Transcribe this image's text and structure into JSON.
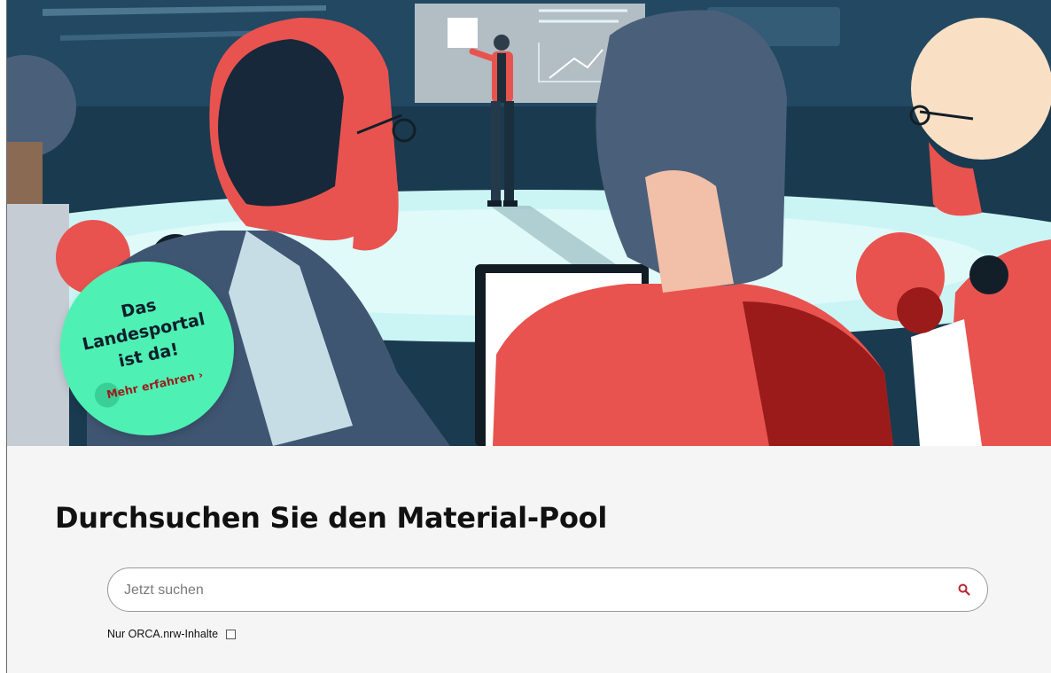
{
  "hero": {
    "badge": {
      "title": "Das\nLandesportal\nist da!",
      "link_label": "Mehr erfahren",
      "link_chevron": "›",
      "color": "#4ff0b4"
    },
    "illustration": "classroom-presentation-illustration"
  },
  "search_section": {
    "headline": "Durchsuchen Sie den Material-Pool",
    "search": {
      "placeholder": "Jetzt suchen",
      "value": "",
      "icon": "search-icon",
      "icon_color": "#b8232f"
    },
    "filter": {
      "label": "Nur ORCA.nrw-Inhalte",
      "checked": false
    }
  },
  "colors": {
    "background": "#f5f5f5",
    "headline": "#111111",
    "accent_red": "#e8534f",
    "navy": "#16364a"
  }
}
